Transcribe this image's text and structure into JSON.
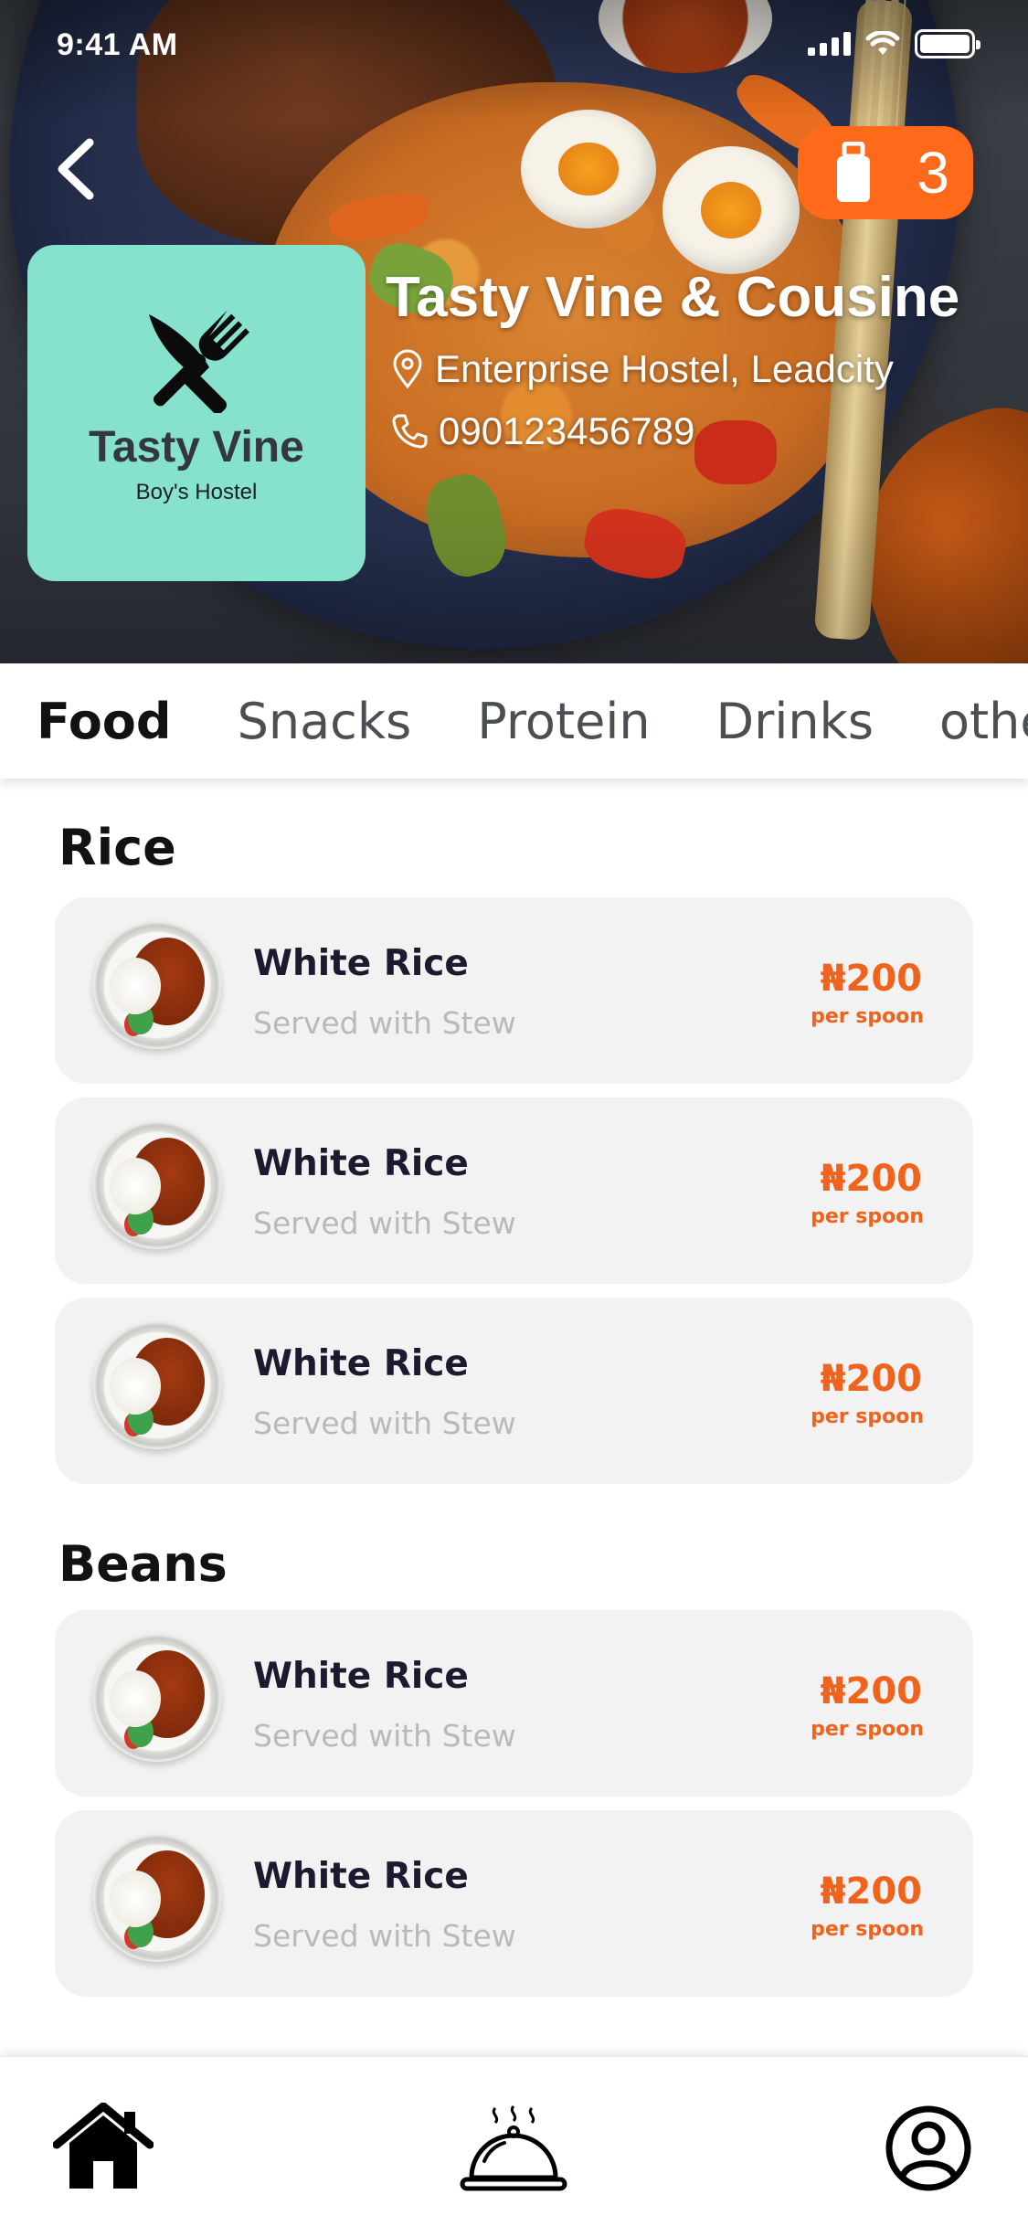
{
  "status_bar": {
    "time": "9:41 AM"
  },
  "header": {
    "cart_count": "3",
    "logo": {
      "title": "Tasty Vine",
      "subtitle": "Boy's Hostel"
    },
    "shop_name": "Tasty Vine & Cousine",
    "address": "Enterprise Hostel, Leadcity",
    "phone": "090123456789"
  },
  "tabs": [
    {
      "label": "Food",
      "active": true
    },
    {
      "label": "Snacks",
      "active": false
    },
    {
      "label": "Protein",
      "active": false
    },
    {
      "label": "Drinks",
      "active": false
    },
    {
      "label": "other",
      "active": false
    }
  ],
  "sections": [
    {
      "title": "Rice",
      "items": [
        {
          "name": "White Rice",
          "description": "Served with Stew",
          "price": "₦200",
          "unit": "per spoon"
        },
        {
          "name": "White Rice",
          "description": "Served with Stew",
          "price": "₦200",
          "unit": "per spoon"
        },
        {
          "name": "White Rice",
          "description": "Served with Stew",
          "price": "₦200",
          "unit": "per spoon"
        }
      ]
    },
    {
      "title": "Beans",
      "items": [
        {
          "name": "White Rice",
          "description": "Served with Stew",
          "price": "₦200",
          "unit": "per spoon"
        },
        {
          "name": "White Rice",
          "description": "Served with Stew",
          "price": "₦200",
          "unit": "per spoon"
        }
      ]
    }
  ],
  "bottom_nav": [
    {
      "icon": "home-icon"
    },
    {
      "icon": "food-cloche-icon"
    },
    {
      "icon": "profile-icon"
    }
  ],
  "colors": {
    "accent": "#ff6a1a",
    "logo_bg": "#86e2cc",
    "card_bg": "#f2f2f3",
    "price": "#f0631c"
  }
}
